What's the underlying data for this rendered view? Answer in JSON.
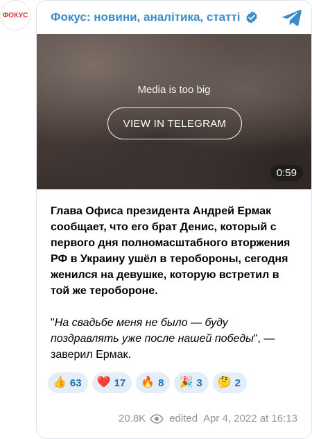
{
  "channel": {
    "avatar_text": "ФОКУС",
    "title": "Фокус: новини, аналітика, статті"
  },
  "media": {
    "note": "Media is too big",
    "button_label": "VIEW IN TELEGRAM",
    "duration": "0:59"
  },
  "post": {
    "main_text": "Глава Офиса президента Андрей Ермак сообщает, что его брат Денис, который с первого дня полномасштабного вторжения РФ в Украину ушёл в теробороны, сегодня женился на девушке, которую встретил в той же тероборонe.",
    "quote_open": "\"",
    "quote_italic": "На свадьбе меня не было — буду поздравлять уже после нашей победы",
    "quote_close": "\", — заверил Ермак."
  },
  "reactions": [
    {
      "emoji": "👍",
      "count": "63",
      "name": "thumbs-up"
    },
    {
      "emoji": "❤️",
      "count": "17",
      "name": "heart"
    },
    {
      "emoji": "🔥",
      "count": "8",
      "name": "fire"
    },
    {
      "emoji": "🎉",
      "count": "3",
      "name": "party"
    },
    {
      "emoji": "🤔",
      "count": "2",
      "name": "thinking"
    }
  ],
  "meta": {
    "views": "20.8K",
    "edited": "edited",
    "date": "Apr 4, 2022 at 16:13"
  },
  "colors": {
    "accent": "#3a8bc9",
    "reaction_bg": "#e4eef8",
    "reaction_text": "#1f6fb0",
    "logo_red": "#e0282e"
  }
}
